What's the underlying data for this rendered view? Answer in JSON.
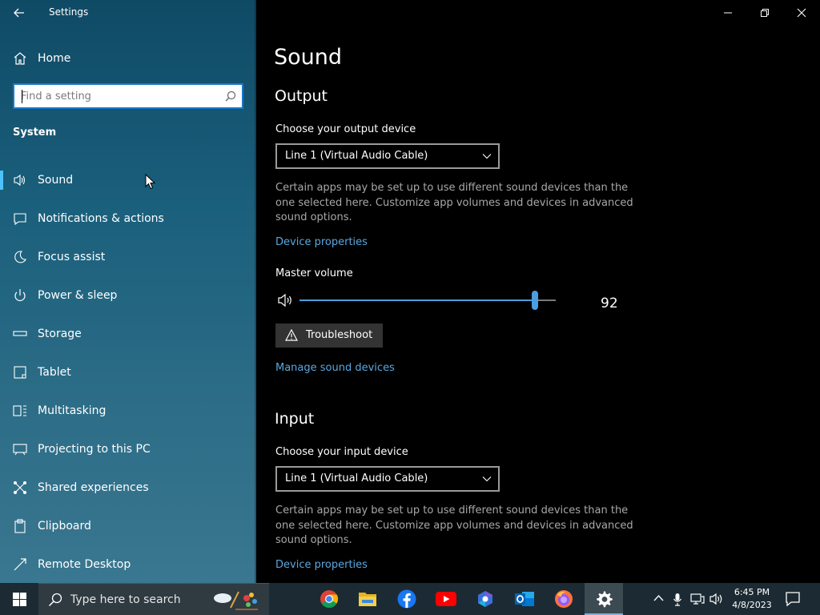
{
  "window": {
    "app_title": "Settings",
    "controls": [
      "minimize",
      "restore",
      "close"
    ]
  },
  "sidebar": {
    "home_label": "Home",
    "search": {
      "placeholder": "Find a setting",
      "value": ""
    },
    "group_title": "System",
    "items": [
      {
        "label": "Sound",
        "icon": "speaker-icon",
        "active": true
      },
      {
        "label": "Notifications & actions",
        "icon": "notification-icon",
        "active": false
      },
      {
        "label": "Focus assist",
        "icon": "moon-icon",
        "active": false
      },
      {
        "label": "Power & sleep",
        "icon": "power-icon",
        "active": false
      },
      {
        "label": "Storage",
        "icon": "storage-icon",
        "active": false
      },
      {
        "label": "Tablet",
        "icon": "tablet-icon",
        "active": false
      },
      {
        "label": "Multitasking",
        "icon": "multitasking-icon",
        "active": false
      },
      {
        "label": "Projecting to this PC",
        "icon": "projecting-icon",
        "active": false
      },
      {
        "label": "Shared experiences",
        "icon": "shared-icon",
        "active": false
      },
      {
        "label": "Clipboard",
        "icon": "clipboard-icon",
        "active": false
      },
      {
        "label": "Remote Desktop",
        "icon": "remote-desktop-icon",
        "active": false
      }
    ]
  },
  "main": {
    "page_title": "Sound",
    "output": {
      "title": "Output",
      "device_label": "Choose your output device",
      "device_value": "Line 1 (Virtual Audio Cable)",
      "help_text": "Certain apps may be set up to use different sound devices than the one selected here. Customize app volumes and devices in advanced sound options.",
      "device_properties_link": "Device properties",
      "master_volume_label": "Master volume",
      "master_volume": 92,
      "troubleshoot_label": "Troubleshoot",
      "manage_devices_link": "Manage sound devices"
    },
    "input": {
      "title": "Input",
      "device_label": "Choose your input device",
      "device_value": "Line 1 (Virtual Audio Cable)",
      "help_text": "Certain apps may be set up to use different sound devices than the one selected here. Customize app volumes and devices in advanced sound options.",
      "device_properties_link": "Device properties"
    }
  },
  "taskbar": {
    "search_placeholder": "Type here to search",
    "apps": [
      {
        "name": "chrome",
        "active": false
      },
      {
        "name": "file-explorer",
        "active": false
      },
      {
        "name": "facebook",
        "active": false
      },
      {
        "name": "youtube",
        "active": false
      },
      {
        "name": "copilot",
        "active": false
      },
      {
        "name": "outlook",
        "active": false
      },
      {
        "name": "firefox",
        "active": false
      },
      {
        "name": "settings",
        "active": true
      }
    ],
    "clock": {
      "time": "6:45 PM",
      "date": "4/8/2023"
    }
  },
  "colors": {
    "accent": "#4a9fe0",
    "link": "#5aa7e0",
    "sidebar_top": "#0f4a65",
    "sidebar_bottom": "#3a7790",
    "taskbar": "#1c2b33"
  }
}
